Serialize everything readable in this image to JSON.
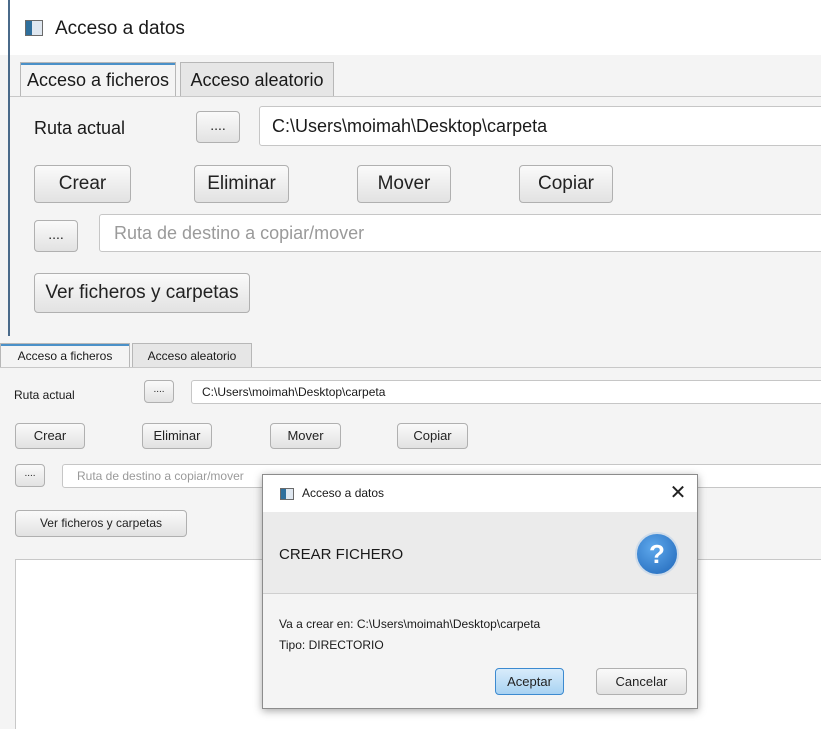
{
  "window_title": "Acceso a datos",
  "icons": {
    "window": "app-window-icon",
    "question": "question-icon",
    "close": "close-icon"
  },
  "colors": {
    "focus_blue": "#4a90c8",
    "default_button": "#a8d2f2",
    "question_blue": "#1f66b8"
  },
  "tabs": [
    "Acceso a ficheros",
    "Acceso aleatorio"
  ],
  "ruta_label": "Ruta actual",
  "browse_button": "....",
  "ruta_value": "C:\\Users\\moimah\\Desktop\\carpeta",
  "buttons": {
    "crear": "Crear",
    "eliminar": "Eliminar",
    "mover": "Mover",
    "copiar": "Copiar"
  },
  "destino_placeholder": "Ruta de destino a copiar/mover",
  "ver_button": "Ver ficheros y carpetas",
  "dialog": {
    "title": "Acceso a datos",
    "close_glyph": "✕",
    "heading": "CREAR FICHERO",
    "icon_glyph": "?",
    "message_line1": "Va a crear en: C:\\Users\\moimah\\Desktop\\carpeta",
    "message_line2": "Tipo: DIRECTORIO",
    "ok_label": "Aceptar",
    "cancel_label": "Cancelar"
  }
}
